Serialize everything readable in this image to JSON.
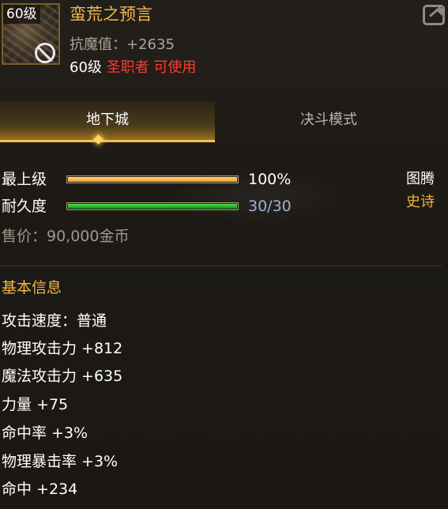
{
  "item": {
    "level_tag": "60级",
    "name": "蛮荒之预言",
    "stat_line": "抗魔值：+2635",
    "req_level": "60级",
    "req_class": "圣职者 可使用"
  },
  "tabs": {
    "dungeon": "地下城",
    "duel": "决斗模式"
  },
  "bars": {
    "upgrade": {
      "label": "最上级",
      "value": "100%",
      "fill_fraction": 1.0
    },
    "durability": {
      "label": "耐久度",
      "value": "30/30",
      "fill_fraction": 1.0
    }
  },
  "emblem": {
    "label": "图腾",
    "value": "史诗"
  },
  "price": "售价：90,000金币",
  "section_title": "基本信息",
  "attributes": [
    "攻击速度：普通",
    "物理攻击力 +812",
    "魔法攻击力 +635",
    "力量 +75",
    "命中率 +3%",
    "物理暴击率 +3%",
    "命中 +234"
  ],
  "colors": {
    "name": "#f2b84a",
    "class_restriction": "#ff3c2e",
    "epic": "#f0b03c",
    "active_tab_underline": "#f4c24c"
  },
  "icons": {
    "item": "item-portrait-icon",
    "restriction": "ban-icon",
    "share": "share-icon"
  }
}
